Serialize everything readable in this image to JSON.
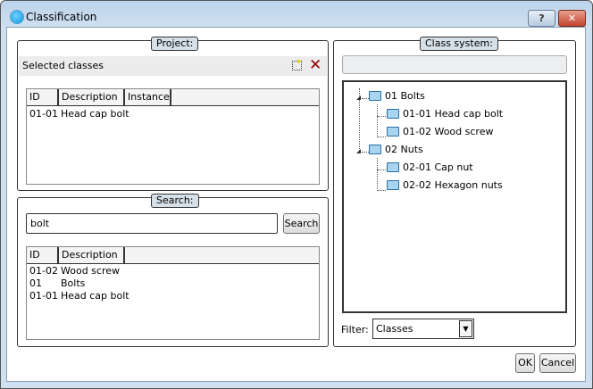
{
  "window": {
    "title": "Classification",
    "help": "?",
    "close": "✕"
  },
  "project": {
    "label": "Project:",
    "selected_classes": "Selected classes",
    "columns": [
      "ID",
      "Description",
      "Instance"
    ],
    "rows": [
      {
        "id": "01-01",
        "description": "Head cap bolt",
        "instance": ""
      }
    ]
  },
  "search": {
    "label": "Search:",
    "value": "bolt",
    "button": "Search",
    "columns": [
      "ID",
      "Description"
    ],
    "rows": [
      {
        "id": "01-02",
        "description": "Wood screw"
      },
      {
        "id": "01",
        "description": "Bolts"
      },
      {
        "id": "01-01",
        "description": "Head cap bolt"
      }
    ]
  },
  "class_system": {
    "label": "Class system:",
    "path": "",
    "tree": [
      {
        "label": "01 Bolts",
        "children": [
          "01-01 Head cap bolt",
          "01-02 Wood screw"
        ]
      },
      {
        "label": "02 Nuts",
        "children": [
          "02-01 Cap nut",
          "02-02 Hexagon nuts"
        ]
      }
    ],
    "filter_label": "Filter:",
    "filter_value": "Classes"
  },
  "buttons": {
    "ok": "OK",
    "cancel": "Cancel"
  }
}
